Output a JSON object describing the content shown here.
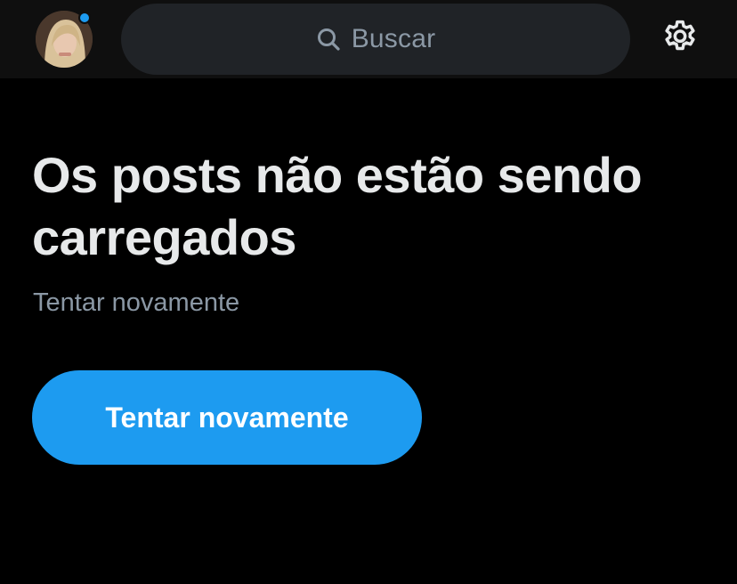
{
  "header": {
    "avatar_icon": "user-avatar",
    "has_notification": true,
    "search": {
      "icon": "search-icon",
      "placeholder": "Buscar"
    },
    "settings_icon": "gear-icon"
  },
  "main": {
    "title": "Os posts não estão sendo carregados",
    "subtitle": "Tentar novamente",
    "retry_button_label": "Tentar novamente"
  },
  "colors": {
    "background": "#000000",
    "top_bar": "#0f0f0f",
    "search_bg": "#202327",
    "accent": "#1d9bf0",
    "primary_text": "#e7e9ea",
    "secondary_text": "#8b98a5"
  }
}
